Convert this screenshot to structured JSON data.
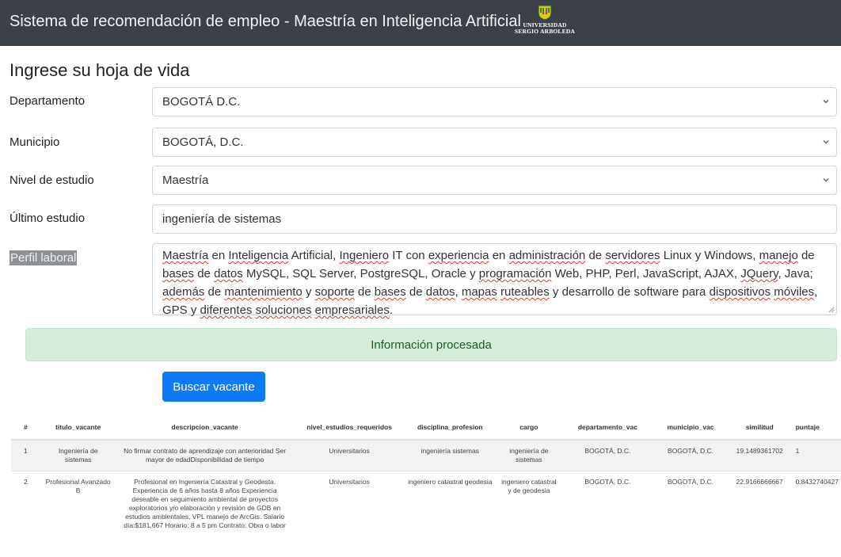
{
  "header": {
    "title": "Sistema de recomendación de empleo - Maestría en Inteligencia Artificial",
    "logo_line1": "UNIVERSIDAD",
    "logo_line2": "SERGIO ARBOLEDA"
  },
  "form": {
    "heading": "Ingrese su hoja de vida",
    "departamento": {
      "label": "Departamento",
      "value": "BOGOTÁ D.C."
    },
    "municipio": {
      "label": "Municipio",
      "value": "BOGOTÁ, D.C."
    },
    "nivel": {
      "label": "Nivel de estudio",
      "value": "Maestría"
    },
    "ultimo": {
      "label": "Último estudio",
      "value": "ingeniería de sistemas"
    },
    "perfil": {
      "label": "Perfil laboral",
      "value": "Maestría en Inteligencia Artificial, Ingeniero IT con experiencia en administración de servidores Linux y Windows, manejo de bases de datos MySQL, SQL Server, PostgreSQL, Oracle y programación Web, PHP, Perl, JavaScript, AJAX, JQuery, Java; además de mantenimiento y soporte de bases de datos, mapas ruteables y desarrollo de software para dispositivos móviles, GPS y diferentes soluciones empresariales."
    }
  },
  "alert": {
    "text": "Información procesada"
  },
  "search_button": {
    "label": "Buscar vacante"
  },
  "results": {
    "columns": [
      "#",
      "titulo_vacante",
      "descripcion_vacante",
      "nivel_estudios_requeridos",
      "disciplina_profesion",
      "cargo",
      "departamento_vac",
      "municipio_vac",
      "similitud",
      "puntaje"
    ],
    "rows": [
      [
        "1",
        "Ingeniería de sistemas",
        "No firmar contrato de aprendizaje con anterioridad Ser mayor de edadDisponibilidad de tiempo",
        "Universitarios",
        "ingeniería sistemas",
        "ingeniería de sistemas",
        "BOGOTÁ, D.C.",
        "BOGOTÁ, D.C.",
        "19.1489361702",
        "1"
      ],
      [
        "2",
        "Profesional Avanzado B",
        "Profesional en Ingeniería Catastral y Geodesta. Experiencia de 6 años hasta 8 años Experiencia deseable en seguimiento ambiental de proyectos exploratorios y/o elaboración y revisión de GDB en estudios ambientales, VPL manejo de ArcGis. Salario día:$181,667 Horario: 8 a 5 pm Contrato: Obra o labor",
        "Universitarios",
        "ingeniero catastral geodesia",
        "ingeniero catastral y de geodesia",
        "BOGOTÁ, D.C.",
        "BOGOTÁ, D.C.",
        "22.9166666667",
        "0.8432740427"
      ]
    ]
  }
}
